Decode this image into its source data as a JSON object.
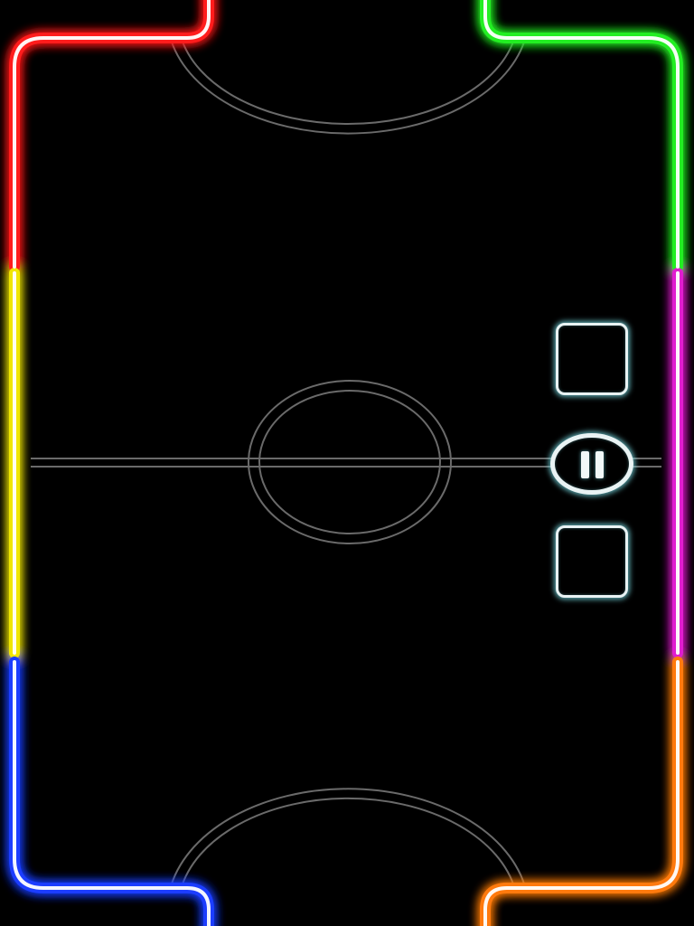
{
  "game": {
    "type": "neon air hockey"
  },
  "colors": {
    "background": "#000000",
    "border_red": "#ff1a1a",
    "border_green": "#22ee22",
    "border_yellow": "#f0e600",
    "border_magenta": "#e01ad0",
    "border_blue": "#1a3cff",
    "border_orange": "#ff7a10",
    "field_lines": "#6a6a6a",
    "button_glow": "#7fdde6"
  },
  "controls": {
    "top_square_icon": "square-outline-icon",
    "pause_icon": "pause-icon",
    "bottom_square_icon": "square-outline-icon"
  }
}
